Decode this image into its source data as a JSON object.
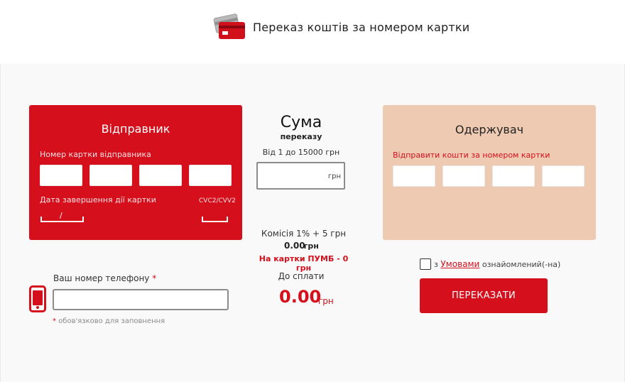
{
  "header": {
    "title": "Переказ коштів за номером картки",
    "icon": "credit-cards-icon"
  },
  "sender": {
    "title": "Відправник",
    "card_number_label": "Номер картки відправника",
    "expiry_label": "Дата завершення дії картки",
    "expiry_separator": "/",
    "cvc_label": "CVC2/CVV2"
  },
  "sum": {
    "title": "Сума",
    "subtitle": "переказу",
    "range": "Від 1 до 15000 грн",
    "unit": "грн",
    "commission": "Комісія 1% + 5 грн",
    "commission_value": "0.00",
    "commission_unit": "грн",
    "pumb_note": "На картки ПУМБ - 0 грн",
    "to_pay_label": "До сплати",
    "total": "0.00",
    "total_unit": "грн"
  },
  "receiver": {
    "title": "Одержувач",
    "card_number_label": "Відправити кошти за номером картки"
  },
  "phone": {
    "label": "Ваш номер телефону",
    "required_mark": "*",
    "required_note_star": "*",
    "required_note": "обов'язково для заповнення",
    "icon": "mobile-phone-icon"
  },
  "agreement": {
    "prefix": "з",
    "link": "Умовами",
    "suffix": "ознайомлений(-на)"
  },
  "submit_label": "ПЕРЕКАЗАТИ",
  "colors": {
    "brand_red": "#d50f1c",
    "receiver_bg": "#efcab3"
  }
}
